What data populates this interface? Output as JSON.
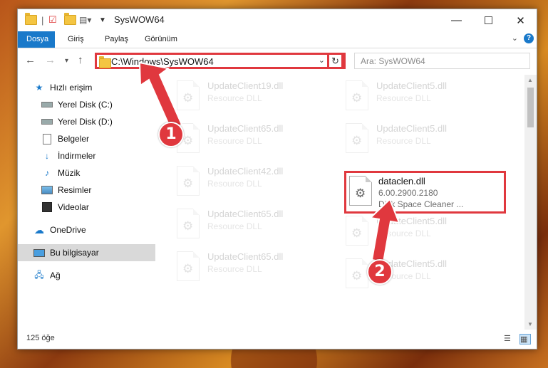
{
  "window": {
    "title": "SysWOW64"
  },
  "ribbon": {
    "tabs": [
      "Dosya",
      "Giriş",
      "Paylaş",
      "Görünüm"
    ],
    "help": "?"
  },
  "address": {
    "path": "C:\\Windows\\SysWOW64"
  },
  "search": {
    "placeholder": "Ara: SysWOW64"
  },
  "sidebar": {
    "items": [
      {
        "label": "Hızlı erişim",
        "icon": "star-icon"
      },
      {
        "label": "Yerel Disk (C:)",
        "icon": "drive-icon"
      },
      {
        "label": "Yerel Disk (D:)",
        "icon": "drive-icon"
      },
      {
        "label": "Belgeler",
        "icon": "documents-icon"
      },
      {
        "label": "İndirmeler",
        "icon": "download-icon"
      },
      {
        "label": "Müzik",
        "icon": "music-icon"
      },
      {
        "label": "Resimler",
        "icon": "pictures-icon"
      },
      {
        "label": "Videolar",
        "icon": "videos-icon"
      },
      {
        "label": "OneDrive",
        "icon": "cloud-icon"
      },
      {
        "label": "Bu bilgisayar",
        "icon": "computer-icon"
      },
      {
        "label": "Ağ",
        "icon": "network-icon"
      }
    ]
  },
  "files": [
    {
      "name": "UpdateClient19.dll",
      "type": "Resource DLL"
    },
    {
      "name": "UpdateClient5.dll",
      "type": "Resource DLL"
    },
    {
      "name": "UpdateClient65.dll",
      "type": "Resource DLL"
    },
    {
      "name": "UpdateClient5.dll",
      "type": "Resource DLL"
    },
    {
      "name": "UpdateClient42.dll",
      "type": "Resource DLL"
    },
    {
      "name": "dataclen.dll",
      "version": "6.00.2900.2180",
      "type": "Disk Space Cleaner ..."
    },
    {
      "name": "UpdateClient65.dll",
      "type": "Resource DLL"
    },
    {
      "name": "UpdateClient5.dll",
      "type": "Resource DLL"
    },
    {
      "name": "UpdateClient65.dll",
      "type": "Resource DLL"
    },
    {
      "name": "UpdateClient5.dll",
      "type": "Resource DLL"
    }
  ],
  "status": {
    "count": "125 öğe"
  },
  "badges": {
    "one": "1",
    "two": "2"
  },
  "colors": {
    "accent": "#1979ca",
    "highlight": "#e0383e"
  }
}
